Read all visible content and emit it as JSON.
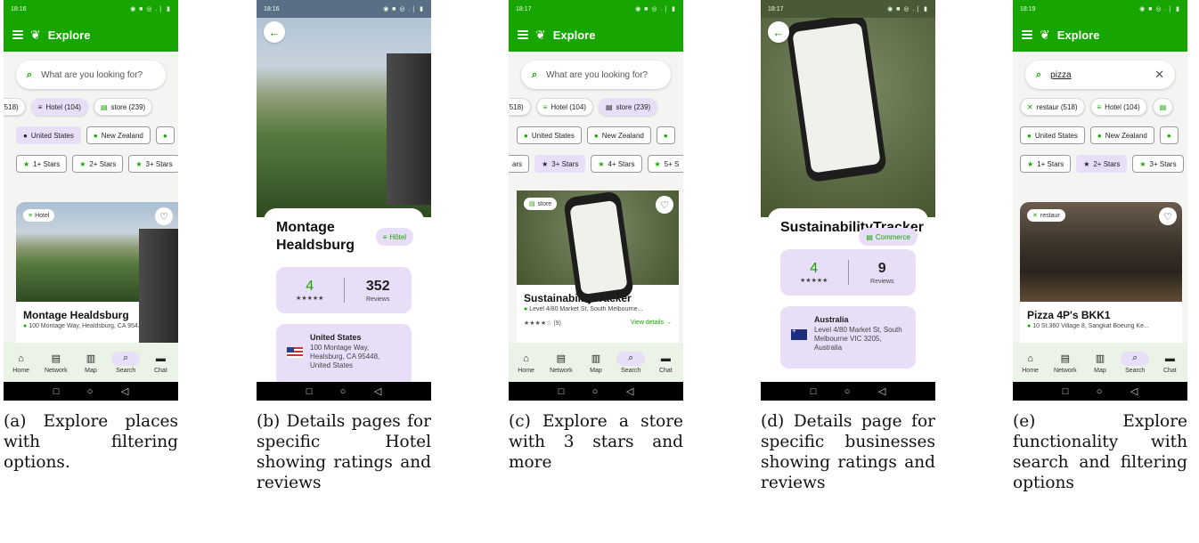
{
  "screens": [
    {
      "status_time": "18:16",
      "status_icons": "◉ ■ ◎ .❘ ▮",
      "title": "Explore",
      "search_placeholder": "What are you looking for?",
      "categories": [
        {
          "label": "(518)",
          "icon": "restaurant-icon",
          "glyph": "",
          "selected": false
        },
        {
          "label": "Hotel (104)",
          "icon": "bed-icon",
          "glyph": "≡",
          "selected": true
        },
        {
          "label": "store (239)",
          "icon": "store-icon",
          "glyph": "▤",
          "selected": false
        }
      ],
      "countries": [
        {
          "label": "United States",
          "selected": true
        },
        {
          "label": "New Zealand",
          "selected": false
        },
        {
          "label": "",
          "selected": false
        }
      ],
      "stars": [
        {
          "label": "1+ Stars",
          "selected": false
        },
        {
          "label": "2+ Stars",
          "selected": false
        },
        {
          "label": "3+ Stars",
          "selected": false
        }
      ],
      "card": {
        "badge": "Hotel",
        "badge_icon": "≡",
        "title": "Montage Healdsburg",
        "address": "100 Montage Way, Healdsburg, CA 954..."
      },
      "caption": "(a) Explore places with filtering options."
    },
    {
      "status_time": "18:16",
      "status_icons": "◉ ■ ◎ .❘ ▮",
      "title": "Montage Healdsburg",
      "type": "Hôtel",
      "type_icon": "≡",
      "rating": "4",
      "reviews_count": "352",
      "reviews_label": "Reviews",
      "star_glyphs": "★★★★★",
      "country": "United States",
      "address": "100 Montage Way, Healsburg, CA 95448, United States",
      "flag": "us",
      "caption": "(b) Details pages for specific Hotel showing ratings and reviews"
    },
    {
      "status_time": "18:17",
      "status_icons": "◉ ■ ◎ .❘ ▮",
      "title": "Explore",
      "search_placeholder": "What are you looking for?",
      "categories": [
        {
          "label": "(518)",
          "icon": "restaurant-icon",
          "glyph": "",
          "selected": false
        },
        {
          "label": "Hotel (104)",
          "icon": "bed-icon",
          "glyph": "≡",
          "selected": false
        },
        {
          "label": "store (239)",
          "icon": "store-icon",
          "glyph": "▤",
          "selected": true
        }
      ],
      "countries": [
        {
          "label": "United States",
          "selected": false
        },
        {
          "label": "New Zealand",
          "selected": false
        },
        {
          "label": "",
          "selected": false
        }
      ],
      "stars": [
        {
          "label": "ars",
          "selected": false
        },
        {
          "label": "3+ Stars",
          "selected": true
        },
        {
          "label": "4+ Stars",
          "selected": false
        },
        {
          "label": "5+ S",
          "selected": false
        }
      ],
      "card": {
        "badge": "store",
        "badge_icon": "▤",
        "title": "SustainabilityTracker",
        "address": "Level 4/80 Market St, South Melbourne...",
        "stars_text": "★★★★☆ (9)",
        "link": "View details →"
      },
      "caption": "(c) Explore a store with 3 stars and more"
    },
    {
      "status_time": "18:17",
      "status_icons": "◉ ■ ◎ .❘ ▮",
      "title": "SustainabilityTracker",
      "type": "Commerce",
      "type_icon": "▤",
      "rating": "4",
      "reviews_count": "9",
      "reviews_label": "Reviews",
      "star_glyphs": "★★★★★",
      "country": "Australia",
      "address": "Level 4/80 Market St, South Melbourne VIC 3205, Australia",
      "flag": "au",
      "caption": "(d) Details page for specific businesses showing ratings and reviews"
    },
    {
      "status_time": "18:19",
      "status_icons": "◉ ■ ◎ .❘ ▮",
      "title": "Explore",
      "search_value": "pizza",
      "categories": [
        {
          "label": "restaur (518)",
          "icon": "restaurant-icon",
          "glyph": "✕",
          "selected": false
        },
        {
          "label": "Hotel (104)",
          "icon": "bed-icon",
          "glyph": "≡",
          "selected": false
        },
        {
          "label": "",
          "icon": "store-icon",
          "glyph": "▤",
          "selected": false
        }
      ],
      "countries": [
        {
          "label": "United States",
          "selected": false
        },
        {
          "label": "New Zealand",
          "selected": false
        },
        {
          "label": "",
          "selected": false
        }
      ],
      "stars": [
        {
          "label": "1+ Stars",
          "selected": false
        },
        {
          "label": "2+ Stars",
          "selected": true
        },
        {
          "label": "3+ Stars",
          "selected": false
        }
      ],
      "card": {
        "badge": "restaur",
        "badge_icon": "✕",
        "title": "Pizza 4P's BKK1",
        "address": "10 St.360 Village 8, Sangkat Boeung Ke..."
      },
      "caption": "(e) Explore functionality with search and filtering options"
    }
  ],
  "nav": [
    {
      "label": "Home",
      "icon": "home-icon",
      "glyph": "⌂"
    },
    {
      "label": "Network",
      "icon": "feed-icon",
      "glyph": "▤"
    },
    {
      "label": "Map",
      "icon": "map-icon",
      "glyph": "▥"
    },
    {
      "label": "Search",
      "icon": "search-icon",
      "glyph": "⌕"
    },
    {
      "label": "Chat",
      "icon": "chat-icon",
      "glyph": "▬"
    }
  ],
  "system_nav": {
    "recents": "□",
    "home": "○",
    "back": "◁"
  },
  "icons": {
    "menu": "menu-icon",
    "leaf": "leaf-icon",
    "search": "search-icon",
    "favorite": "heart-icon",
    "back": "back-arrow-icon",
    "pin": "location-pin-icon",
    "star": "star-icon",
    "clear": "close-icon"
  },
  "glyphs": {
    "leaf": "❦",
    "search": "⌕",
    "heart": "♡",
    "back": "←",
    "pin": "●",
    "star": "★",
    "clear": "✕"
  },
  "colors": {
    "primary": "#17a500",
    "selected_chip": "#e8def8",
    "nav_bg": "#eaf3e6"
  }
}
